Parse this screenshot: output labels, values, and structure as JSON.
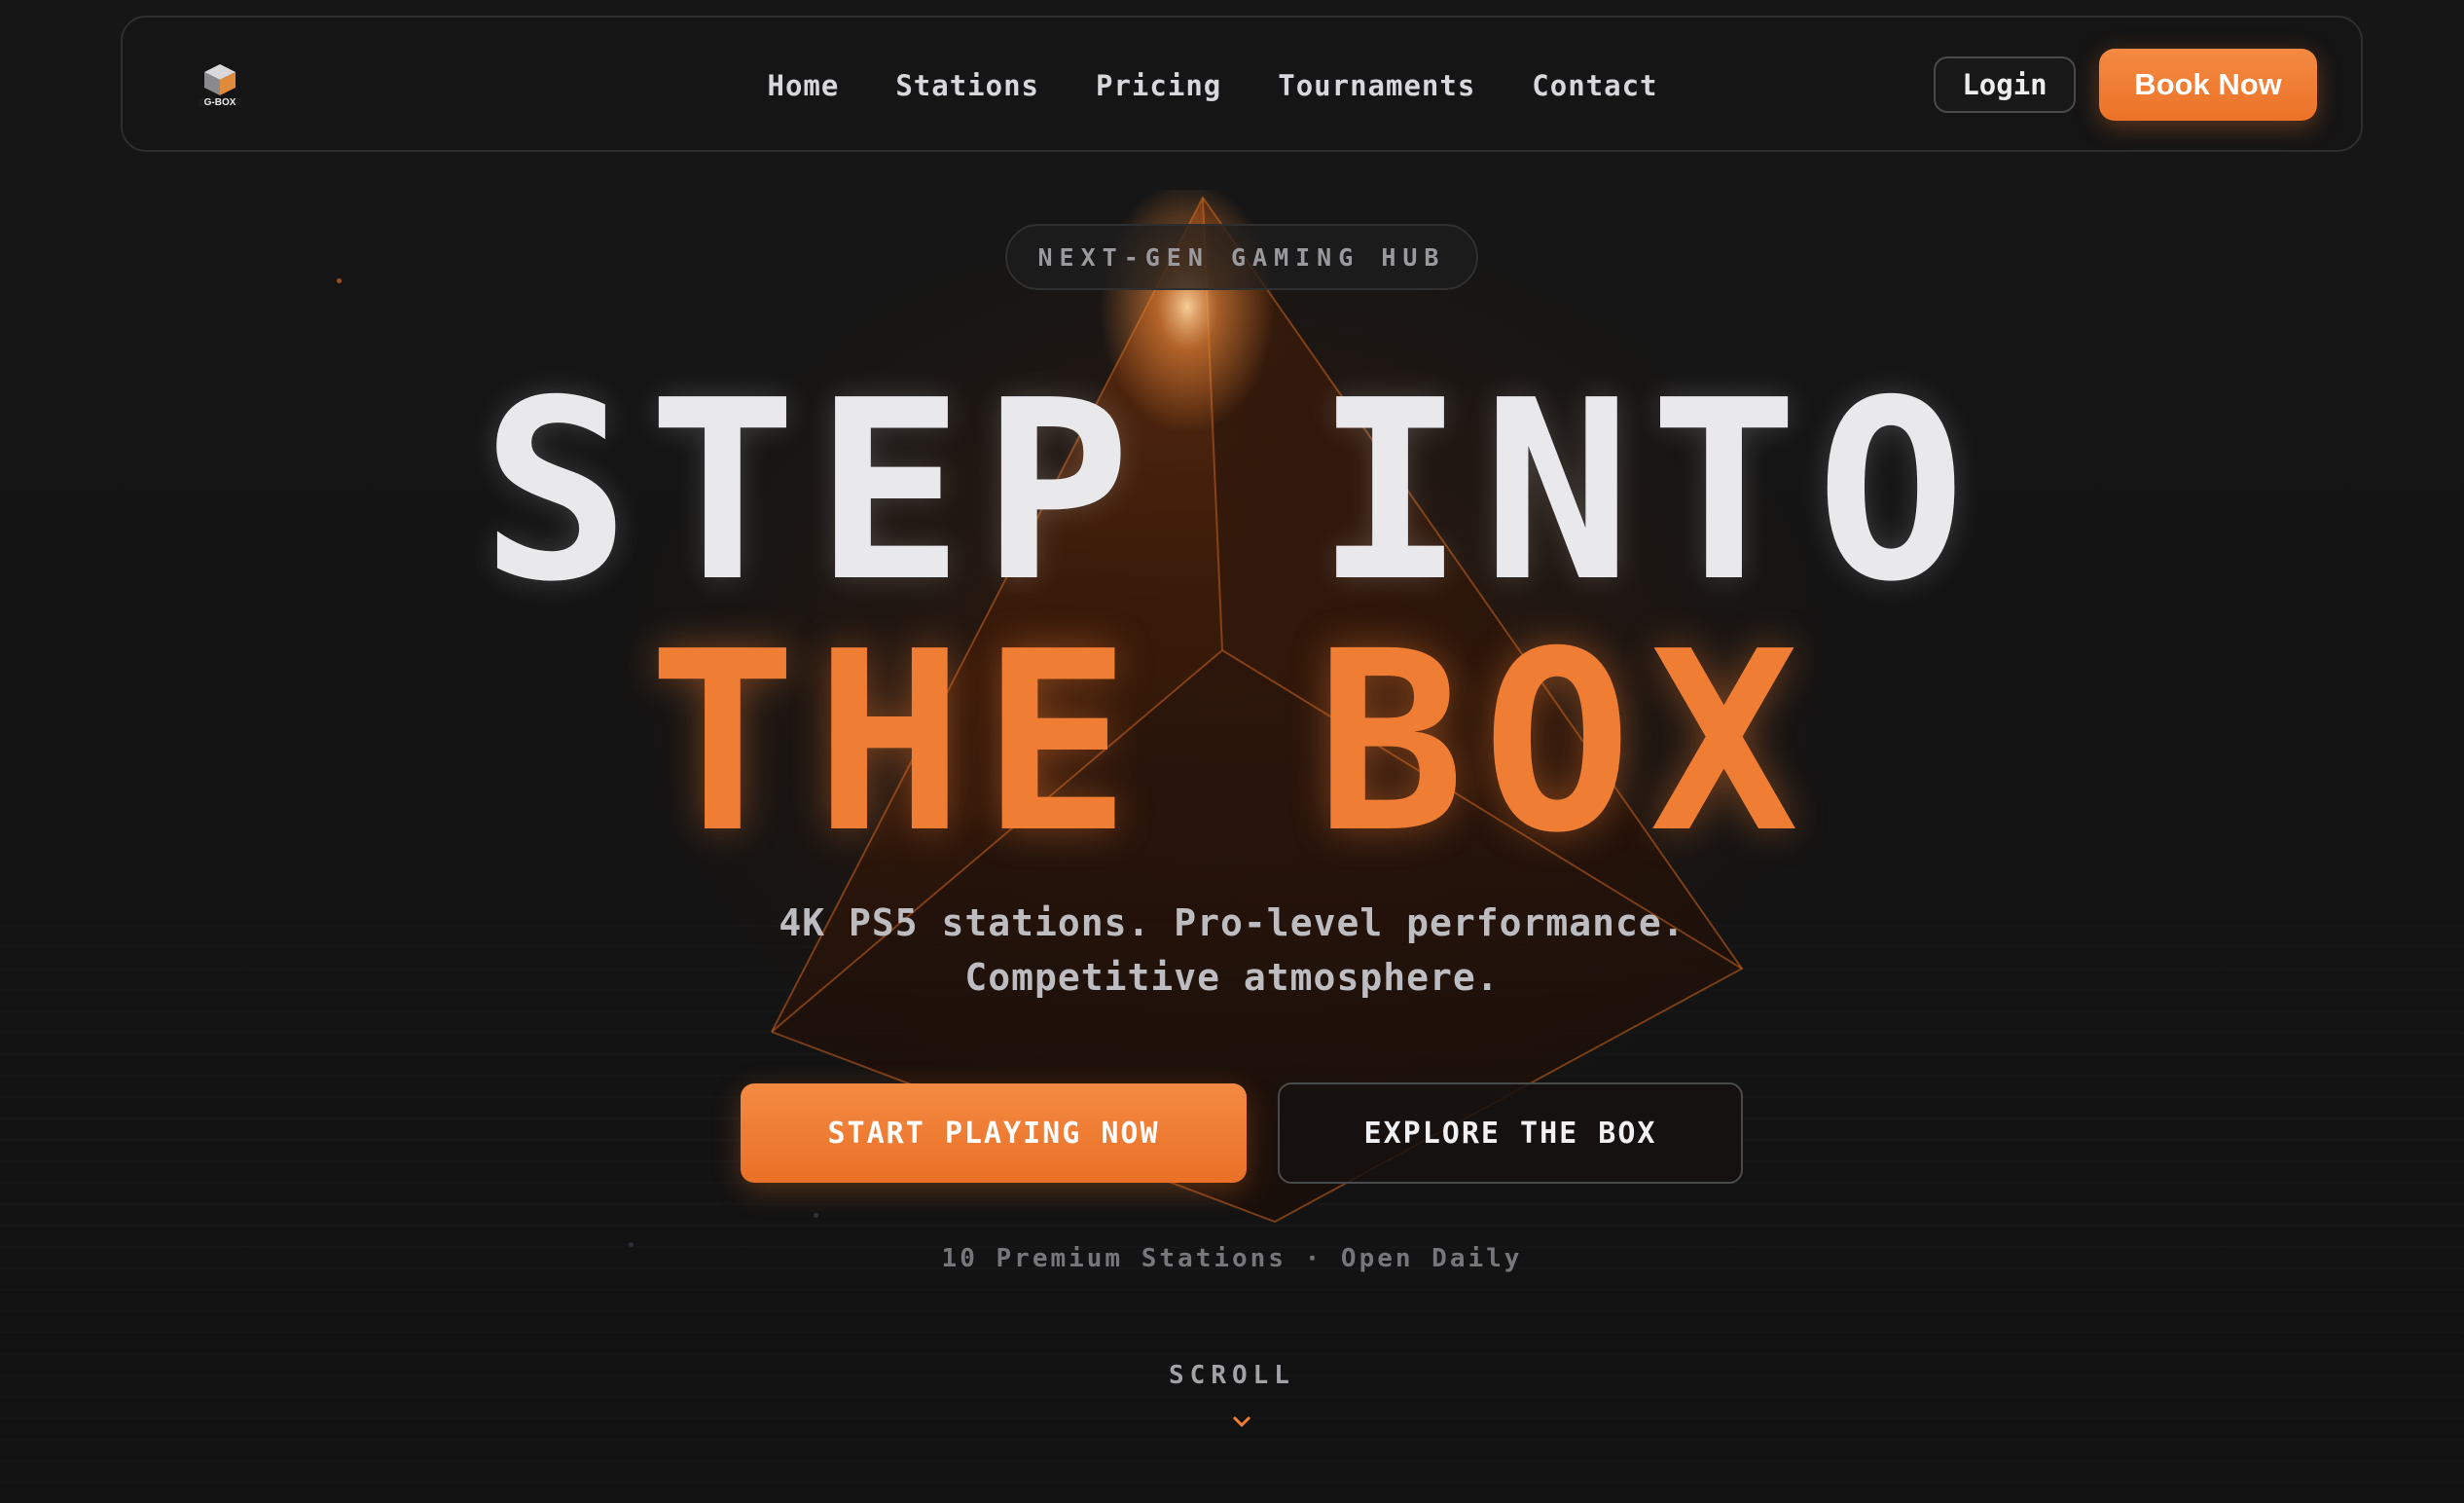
{
  "nav": {
    "logo_text": "G-BOX",
    "links": [
      "Home",
      "Stations",
      "Pricing",
      "Tournaments",
      "Contact"
    ],
    "login_label": "Login",
    "book_label": "Book Now"
  },
  "hero": {
    "badge": "NEXT-GEN GAMING HUB",
    "headline_line1": "STEP INTO",
    "headline_line2": "THE BOX",
    "subtitle_line1": "4K PS5 stations. Pro-level performance.",
    "subtitle_line2": "Competitive atmosphere.",
    "primary_cta": "START PLAYING NOW",
    "secondary_cta": "EXPLORE THE BOX",
    "stats": "10 Premium Stations · Open Daily",
    "scroll_label": "SCROLL"
  },
  "colors": {
    "accent": "#ef7d33",
    "background": "#141414",
    "headline_white": "#e9e9ec"
  },
  "icons": {
    "logo": "cube-logo-icon",
    "scroll": "chevron-down-icon"
  }
}
